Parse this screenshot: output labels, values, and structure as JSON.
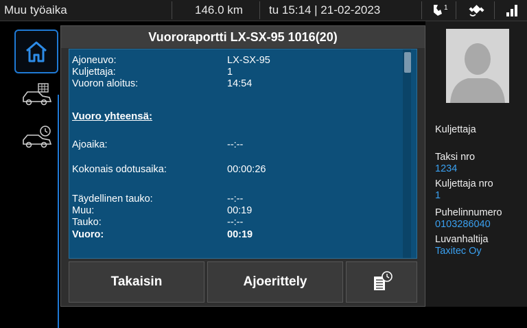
{
  "status_bar": {
    "status": "Muu työaika",
    "distance": "146.0 km",
    "datetime": "tu 15:14 | 21-02-2023",
    "icons": [
      "phone-signal-icon",
      "gps-icon",
      "network-signal-icon"
    ],
    "phone_badge": "1"
  },
  "nav": {
    "items": [
      "home-icon",
      "taxi-meter-icon",
      "taxi-clock-icon"
    ]
  },
  "dialog": {
    "title": "Vuororaportti LX-SX-95 1016(20)",
    "rows": [
      {
        "label": "Ajoneuvo:",
        "value": "LX-SX-95"
      },
      {
        "label": "Kuljettaja:",
        "value": "1"
      },
      {
        "label": "Vuoron aloitus:",
        "value": "14:54"
      }
    ],
    "section_heading": "Vuoro yhteensä:",
    "totals": [
      {
        "label": "Ajoaika:",
        "value": "--:--"
      },
      {
        "label": "Kokonais odotusaika:",
        "value": "00:00:26"
      },
      {
        "label": "Täydellinen tauko:",
        "value": "--:--"
      },
      {
        "label": "Muu:",
        "value": "00:19"
      },
      {
        "label": "Tauko:",
        "value": "--:--"
      },
      {
        "label": "Vuoro:",
        "value": "00:19"
      }
    ],
    "buttons": {
      "back": "Takaisin",
      "details": "Ajoerittely",
      "print_icon": "print-report-icon"
    }
  },
  "driver": {
    "heading": "Kuljettaja",
    "taxi_label": "Taksi nro",
    "taxi_value": "1234",
    "driver_label": "Kuljettaja nro",
    "driver_value": "1",
    "phone_label": "Puhelinnumero",
    "phone_value": "0103286040",
    "owner_label": "Luvanhaltija",
    "owner_value": "Taxitec Oy"
  },
  "colors": {
    "accent": "#1f7ad6",
    "report_bg": "#0d4f79",
    "link_value": "#3aa0f0"
  }
}
